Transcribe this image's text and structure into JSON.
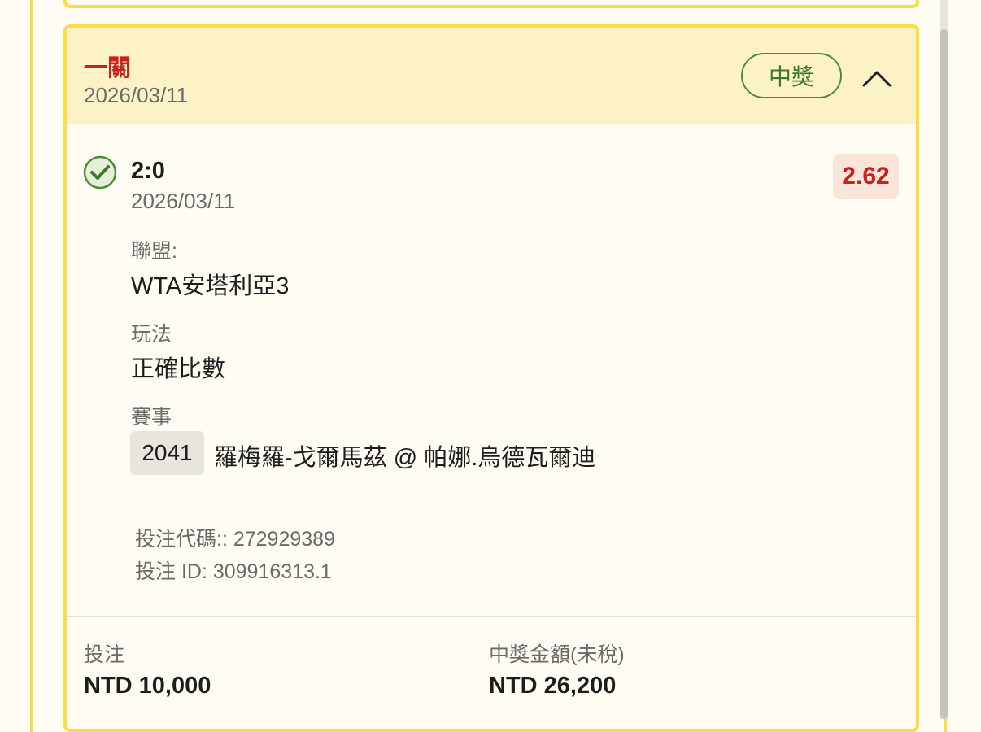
{
  "card": {
    "title": "一關",
    "date": "2026/03/11",
    "status_badge": "中獎",
    "colors": {
      "accent_border": "#f7dd47",
      "header_bg": "#fcf2c6",
      "title_red": "#c8221f",
      "win_green": "#4e8a37"
    }
  },
  "selection": {
    "score": "2:0",
    "date": "2026/03/11",
    "odds": "2.62",
    "league_label": "聯盟:",
    "league_value": "WTA安塔利亞3",
    "market_label": "玩法",
    "market_value": "正確比數",
    "event_label": "賽事",
    "event_code": "2041",
    "event_name": "羅梅羅-戈爾馬茲 @ 帕娜.烏德瓦爾迪"
  },
  "bet_info": {
    "code": "投注代碼:: 272929389",
    "id": "投注 ID: 309916313.1"
  },
  "summary": {
    "stake_label": "投注",
    "stake_value": "NTD 10,000",
    "payout_label": "中獎金額(未稅)",
    "payout_value": "NTD 26,200"
  },
  "icons": {
    "check": "check-circle-icon",
    "collapse": "chevron-up-icon"
  }
}
